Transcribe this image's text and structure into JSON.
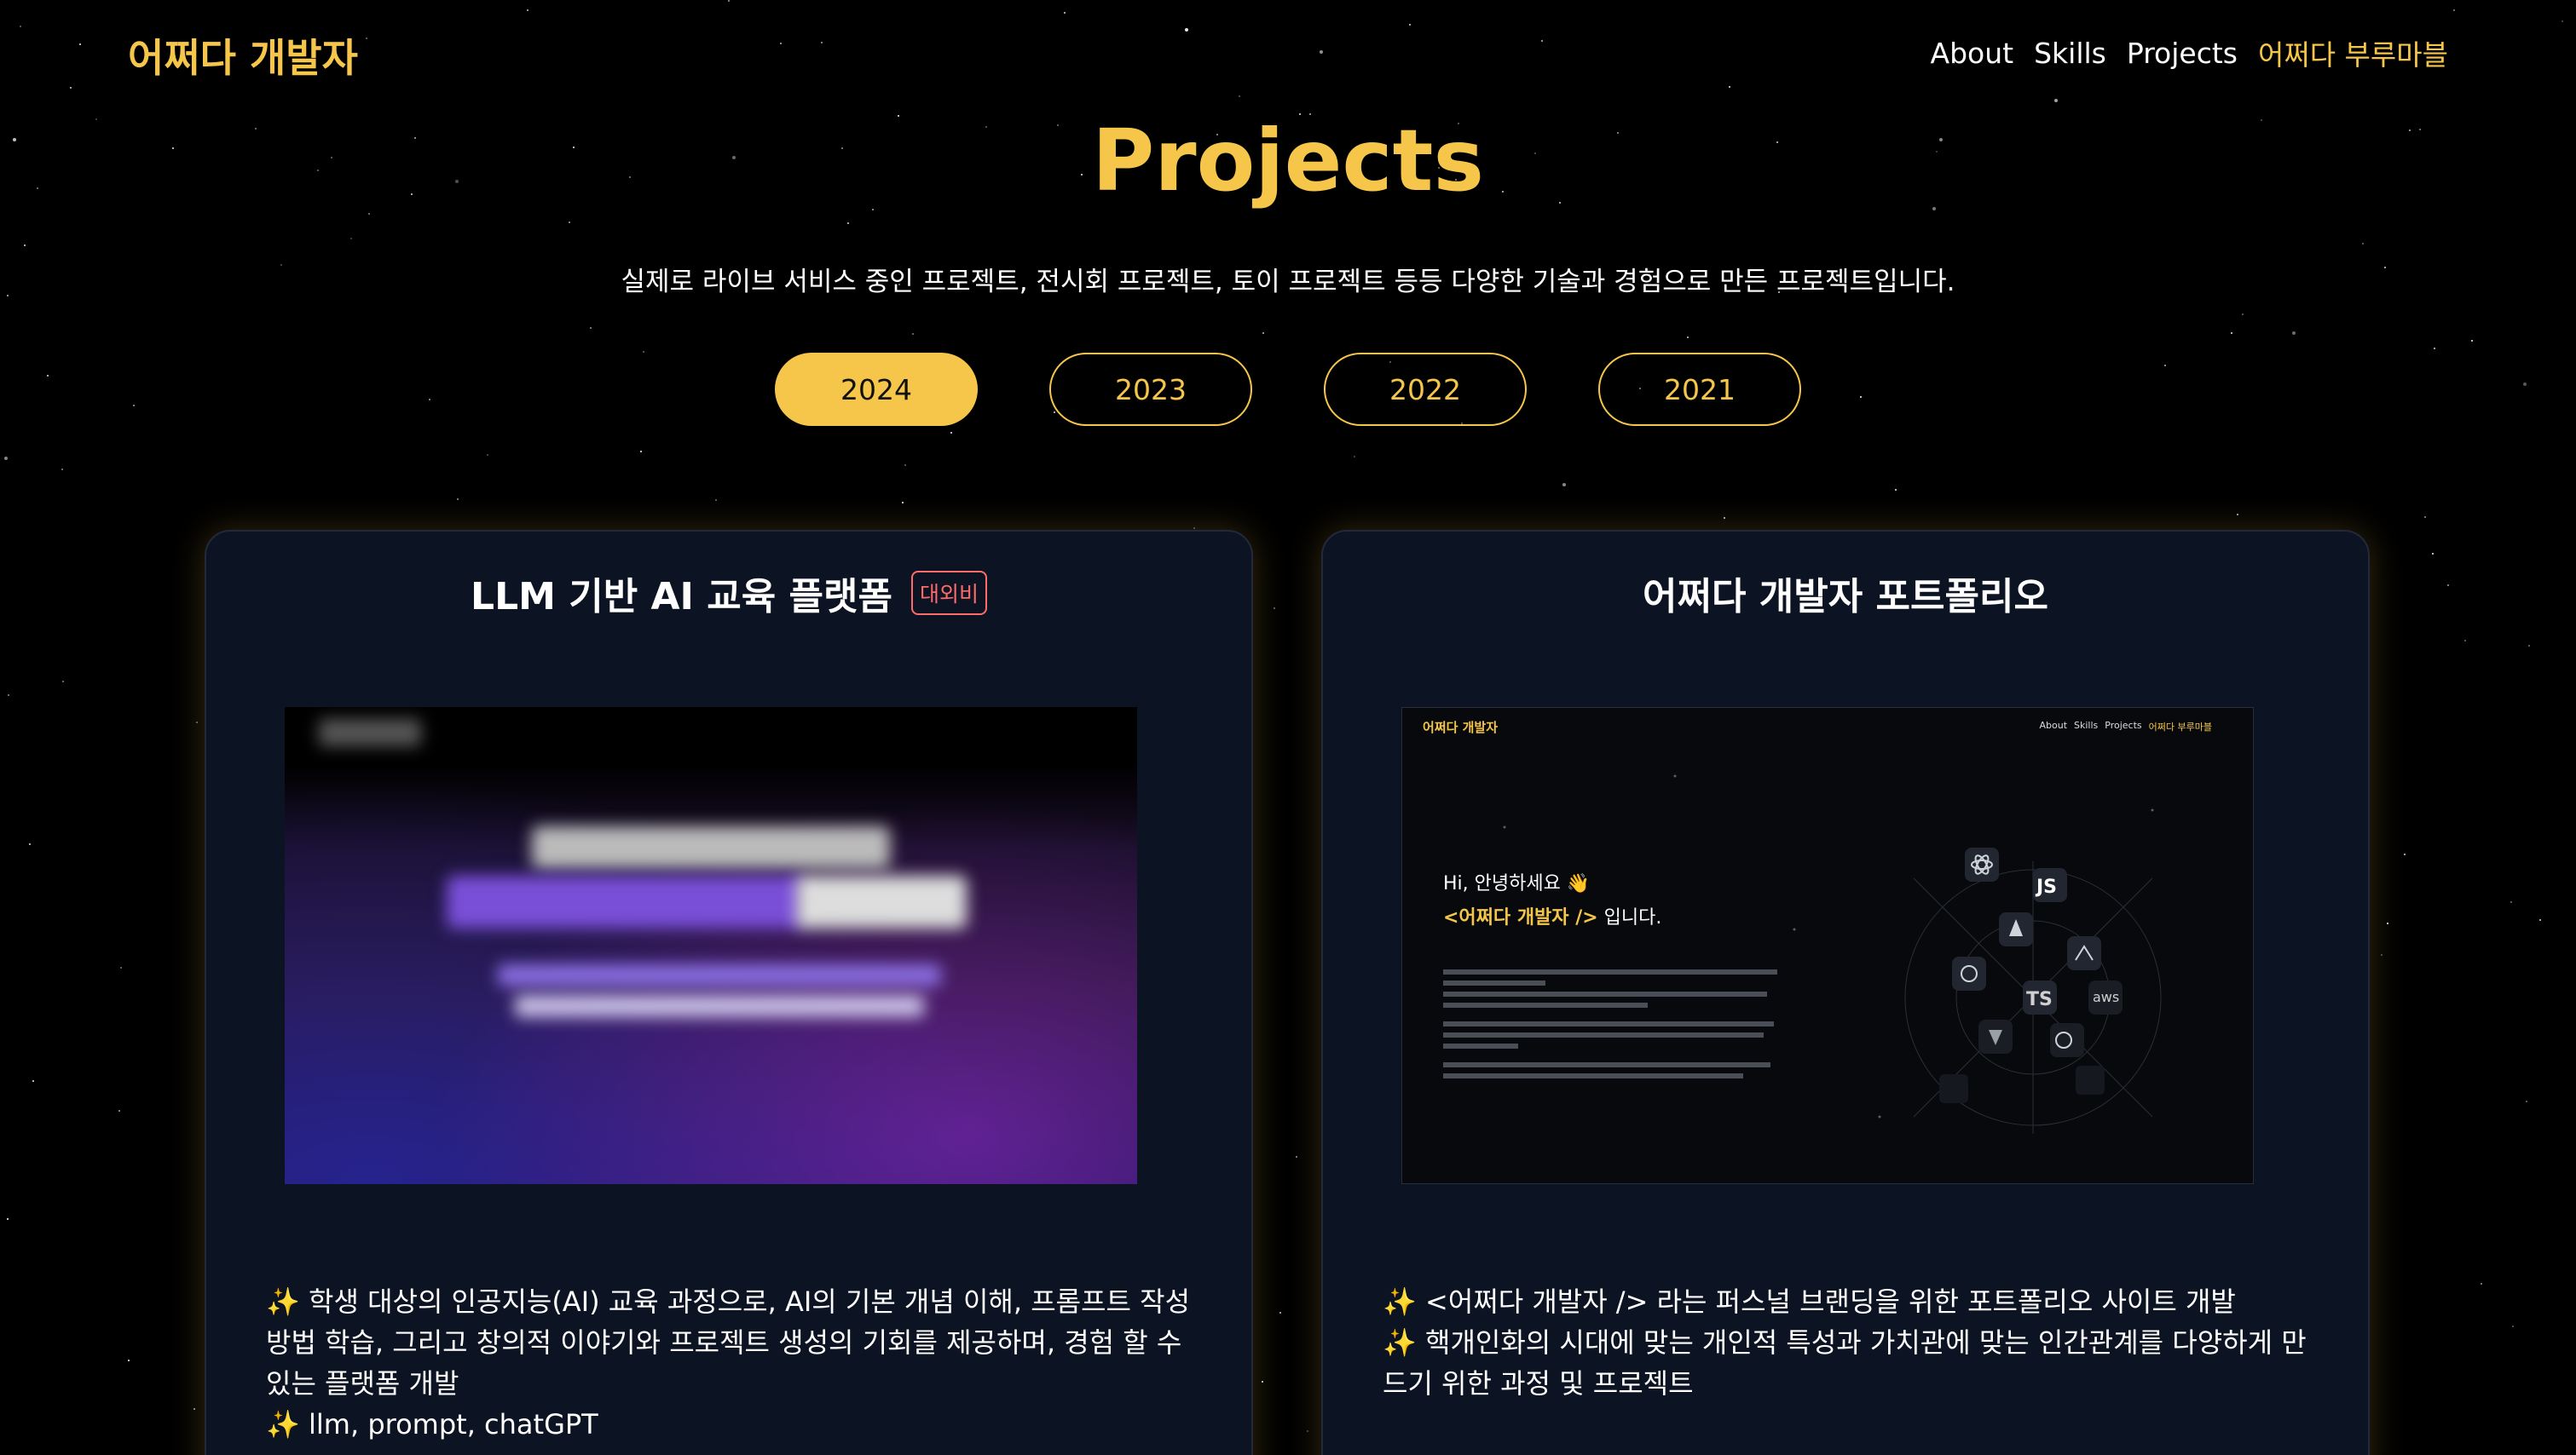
{
  "header": {
    "logo": "어쩌다 개발자",
    "nav": [
      {
        "label": "About"
      },
      {
        "label": "Skills"
      },
      {
        "label": "Projects"
      },
      {
        "label": "어쩌다 부루마블"
      }
    ]
  },
  "section": {
    "title": "Projects",
    "subtitle": "실제로 라이브 서비스 중인 프로젝트, 전시회 프로젝트, 토이 프로젝트 등등 다양한 기술과 경험으로 만든 프로젝트입니다."
  },
  "years": [
    {
      "label": "2024",
      "active": true
    },
    {
      "label": "2023"
    },
    {
      "label": "2022"
    },
    {
      "label": "2021"
    }
  ],
  "projects": [
    {
      "title": "LLM 기반 AI 교육 플랫폼",
      "badge": "대외비",
      "desc": [
        "✨ 학생 대상의 인공지능(AI) 교육 과정으로, AI의 기본 개념 이해, 프롬프트 작성 방법 학습, 그리고 창의적 이야기와 프로젝트 생성의 기회를 제공하며, 경험 할 수 있는 플랫폼 개발",
        "✨ llm, prompt, chatGPT"
      ]
    },
    {
      "title": "어쩌다 개발자 포트폴리오",
      "desc": [
        "✨ <어쩌다 개발자 /> 라는 퍼스널 브랜딩을 위한 포트폴리오 사이트 개발",
        "✨ 핵개인화의 시대에 맞는 개인적 특성과 가치관에 맞는 인간관계를 다양하게 만드기 위한 과정 및 프로젝트"
      ],
      "preview": {
        "logo": "어쩌다 개발자",
        "nav": [
          "About",
          "Skills",
          "Projects",
          "어쩌다 부루마블"
        ],
        "greeting": "Hi, 안녕하세요 👋",
        "headline_accent": "<어쩌다 개발자 />",
        "headline_rest": " 입니다.",
        "skill_labels": [
          "JS",
          "TS",
          "aws"
        ]
      }
    }
  ],
  "colors": {
    "accent": "#f6c64a",
    "card_bg": "#0c1322",
    "badge": "#ff6b6b",
    "background": "#000000"
  }
}
